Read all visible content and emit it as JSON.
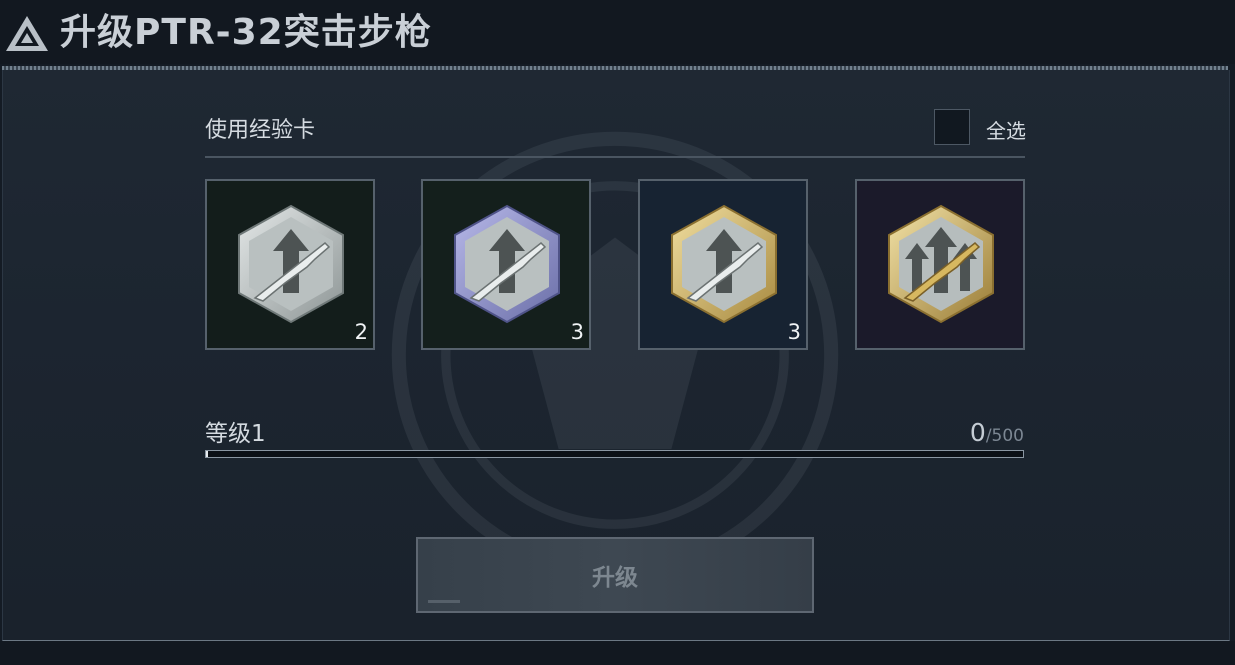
{
  "header": {
    "title": "升级PTR-32突击步枪",
    "logo_icon": "triangle-logo-icon"
  },
  "exp_cards": {
    "section_label": "使用经验卡",
    "select_all_label": "全选",
    "select_all_checked": false,
    "cards": [
      {
        "tier": "silver",
        "count": "2",
        "icon": "exp-card-silver-icon",
        "bg": "#131d1b"
      },
      {
        "tier": "purple",
        "count": "3",
        "icon": "exp-card-purple-icon",
        "bg": "#141f1c"
      },
      {
        "tier": "gold",
        "count": "3",
        "icon": "exp-card-gold-icon",
        "bg": "#172332"
      },
      {
        "tier": "gold-plus",
        "count": "",
        "icon": "exp-card-gold-plus-icon",
        "bg": "#1b1a2a"
      }
    ]
  },
  "level": {
    "label": "等级1",
    "current": "0",
    "max": "/500",
    "progress": 0
  },
  "upgrade_button": {
    "label": "升级",
    "enabled": false
  }
}
